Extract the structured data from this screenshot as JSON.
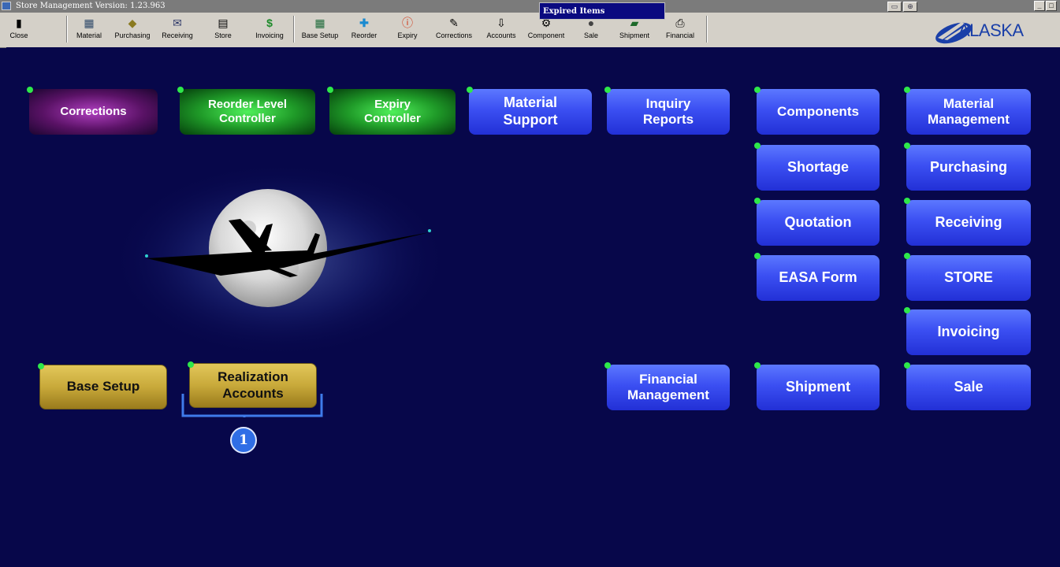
{
  "window": {
    "title": "Store Management  Version: 1.23.963",
    "controls": [
      "_",
      "□"
    ]
  },
  "popup": {
    "label": "Expired Items"
  },
  "toolbar": {
    "items": [
      {
        "label": "Close",
        "icon": "close-door-icon"
      },
      {
        "label": "Material",
        "icon": "material-icon"
      },
      {
        "label": "Purchasing",
        "icon": "purchasing-icon"
      },
      {
        "label": "Receiving",
        "icon": "receiving-icon"
      },
      {
        "label": "Store",
        "icon": "store-icon"
      },
      {
        "label": "Invoicing",
        "icon": "dollar-icon"
      },
      {
        "label": "Base Setup",
        "icon": "grid-icon"
      },
      {
        "label": "Reorder",
        "icon": "plus-icon"
      },
      {
        "label": "Expiry",
        "icon": "info-icon"
      },
      {
        "label": "Corrections",
        "icon": "corrections-icon"
      },
      {
        "label": "Accounts",
        "icon": "accounts-icon"
      },
      {
        "label": "Component",
        "icon": "component-icon"
      },
      {
        "label": "Sale",
        "icon": "sale-icon"
      },
      {
        "label": "Shipment",
        "icon": "truck-icon"
      },
      {
        "label": "Financial",
        "icon": "printer-icon"
      }
    ],
    "logo_text": "ALASKA"
  },
  "tiles": {
    "corrections": "Corrections",
    "reorder": "Reorder Level Controller",
    "expiry": "Expiry Controller",
    "material_support": "Material Support",
    "inquiry_reports": "Inquiry Reports",
    "components": "Components",
    "material_management": "Material Management",
    "shortage": "Shortage",
    "purchasing": "Purchasing",
    "quotation": "Quotation",
    "receiving": "Receiving",
    "easa_form": "EASA Form",
    "store": "STORE",
    "invoicing": "Invoicing",
    "base_setup": "Base Setup",
    "realization_accounts": "Realization Accounts",
    "financial_management": "Financial Management",
    "shipment": "Shipment",
    "sale": "Sale"
  },
  "annotation": {
    "badge": "1"
  },
  "colors": {
    "background": "#07074a",
    "tile_blue": "#3b4ff2",
    "tile_gold": "#c8a93a",
    "tile_green": "#1f9a28",
    "tile_purple": "#5a1266",
    "status_dot": "#2ee84a"
  }
}
